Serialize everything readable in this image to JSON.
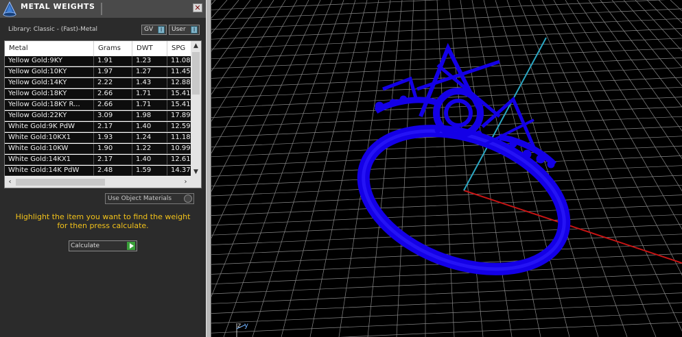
{
  "window": {
    "title": "METAL WEIGHTS",
    "close_glyph": "✕"
  },
  "library_label": "Library: Classic - (Fast)-Metal",
  "toggles": {
    "gv": "GV",
    "user": "User"
  },
  "table": {
    "columns": [
      "Metal",
      "Grams",
      "DWT",
      "SPG"
    ],
    "rows": [
      [
        "Yellow Gold:9KY",
        "1.91",
        "1.23",
        "11.08"
      ],
      [
        "Yellow Gold:10KY",
        "1.97",
        "1.27",
        "11.45"
      ],
      [
        "Yellow Gold:14KY",
        "2.22",
        "1.43",
        "12.88"
      ],
      [
        "Yellow Gold:18KY",
        "2.66",
        "1.71",
        "15.41"
      ],
      [
        "Yellow Gold:18KY R...",
        "2.66",
        "1.71",
        "15.41"
      ],
      [
        "Yellow Gold:22KY",
        "3.09",
        "1.98",
        "17.89"
      ],
      [
        "White Gold:9K PdW",
        "2.17",
        "1.40",
        "12.59"
      ],
      [
        "White Gold:10KX1",
        "1.93",
        "1.24",
        "11.18"
      ],
      [
        "White Gold:10KW",
        "1.90",
        "1.22",
        "10.99"
      ],
      [
        "White Gold:14KX1",
        "2.17",
        "1.40",
        "12.61"
      ],
      [
        "White Gold:14K PdW",
        "2.48",
        "1.59",
        "14.37"
      ]
    ]
  },
  "use_object_materials": "Use Object Materials",
  "hint_line1": "Highlight the item you want to find the weight",
  "hint_line2": "for then press calculate.",
  "calculate_label": "Calculate",
  "viewport": {
    "axis_z_label": "z",
    "axis_y_label": "y",
    "colors": {
      "grid": "#8a8a8a",
      "ring": "#1400e6",
      "axis_x": "#c81414",
      "axis_y": "#2aa8c4"
    }
  }
}
